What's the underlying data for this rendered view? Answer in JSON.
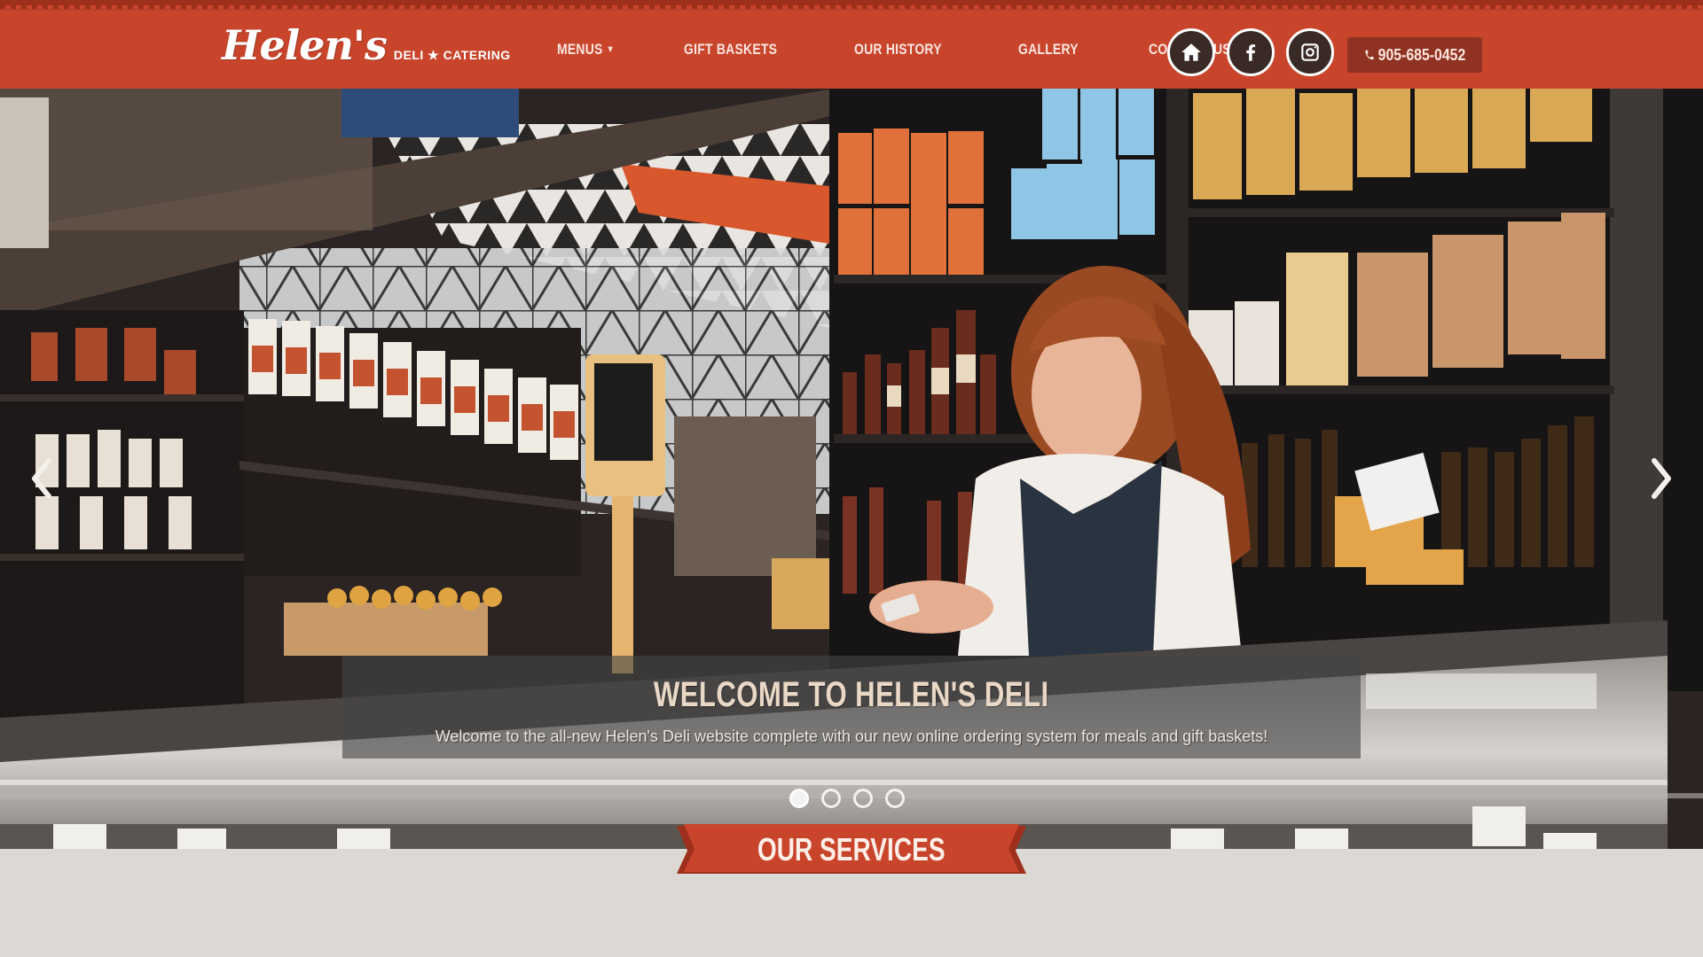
{
  "brand": {
    "name": "Helen's",
    "tagline": "Deli ★ Catering",
    "primary_color": "#c8452c",
    "dark_color": "#3a2a26"
  },
  "nav": {
    "items": [
      {
        "label": "Menus",
        "has_dropdown": true
      },
      {
        "label": "Gift Baskets"
      },
      {
        "label": "Our History"
      },
      {
        "label": "Gallery"
      },
      {
        "label": "Contact Us"
      }
    ]
  },
  "social": {
    "home_icon": "home-icon",
    "facebook_icon": "facebook-icon",
    "instagram_icon": "instagram-icon"
  },
  "phone": {
    "number": "905-685-0452",
    "icon": "phone-icon"
  },
  "hero": {
    "title": "WELCOME TO HELEN'S DELI",
    "text": "Welcome to the all-new Helen's Deli website complete with our new online ordering system for meals and gift baskets!",
    "slide_count": 4,
    "active_slide": 1,
    "prev_icon": "chevron-left-icon",
    "next_icon": "chevron-right-icon"
  },
  "services": {
    "heading": "OUR SERVICES"
  }
}
